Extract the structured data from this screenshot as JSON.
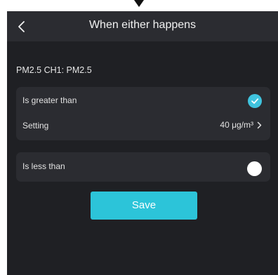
{
  "header": {
    "title": "When either happens"
  },
  "source": {
    "label": "PM2.5 CH1: PM2.5"
  },
  "conditions": {
    "greater": {
      "label": "Is greater than",
      "checked": true
    },
    "setting": {
      "label": "Setting",
      "value": "40 μg/m³"
    },
    "less": {
      "label": "Is less than",
      "checked": false
    }
  },
  "actions": {
    "save_label": "Save"
  },
  "colors": {
    "background": "#1f2024",
    "card": "#2b2c31",
    "accent": "#2cc4d9"
  },
  "icons": {
    "back": "chevron-left-icon",
    "checked": "check-circle-icon",
    "unchecked": "empty-circle-icon",
    "next": "chevron-right-icon"
  }
}
